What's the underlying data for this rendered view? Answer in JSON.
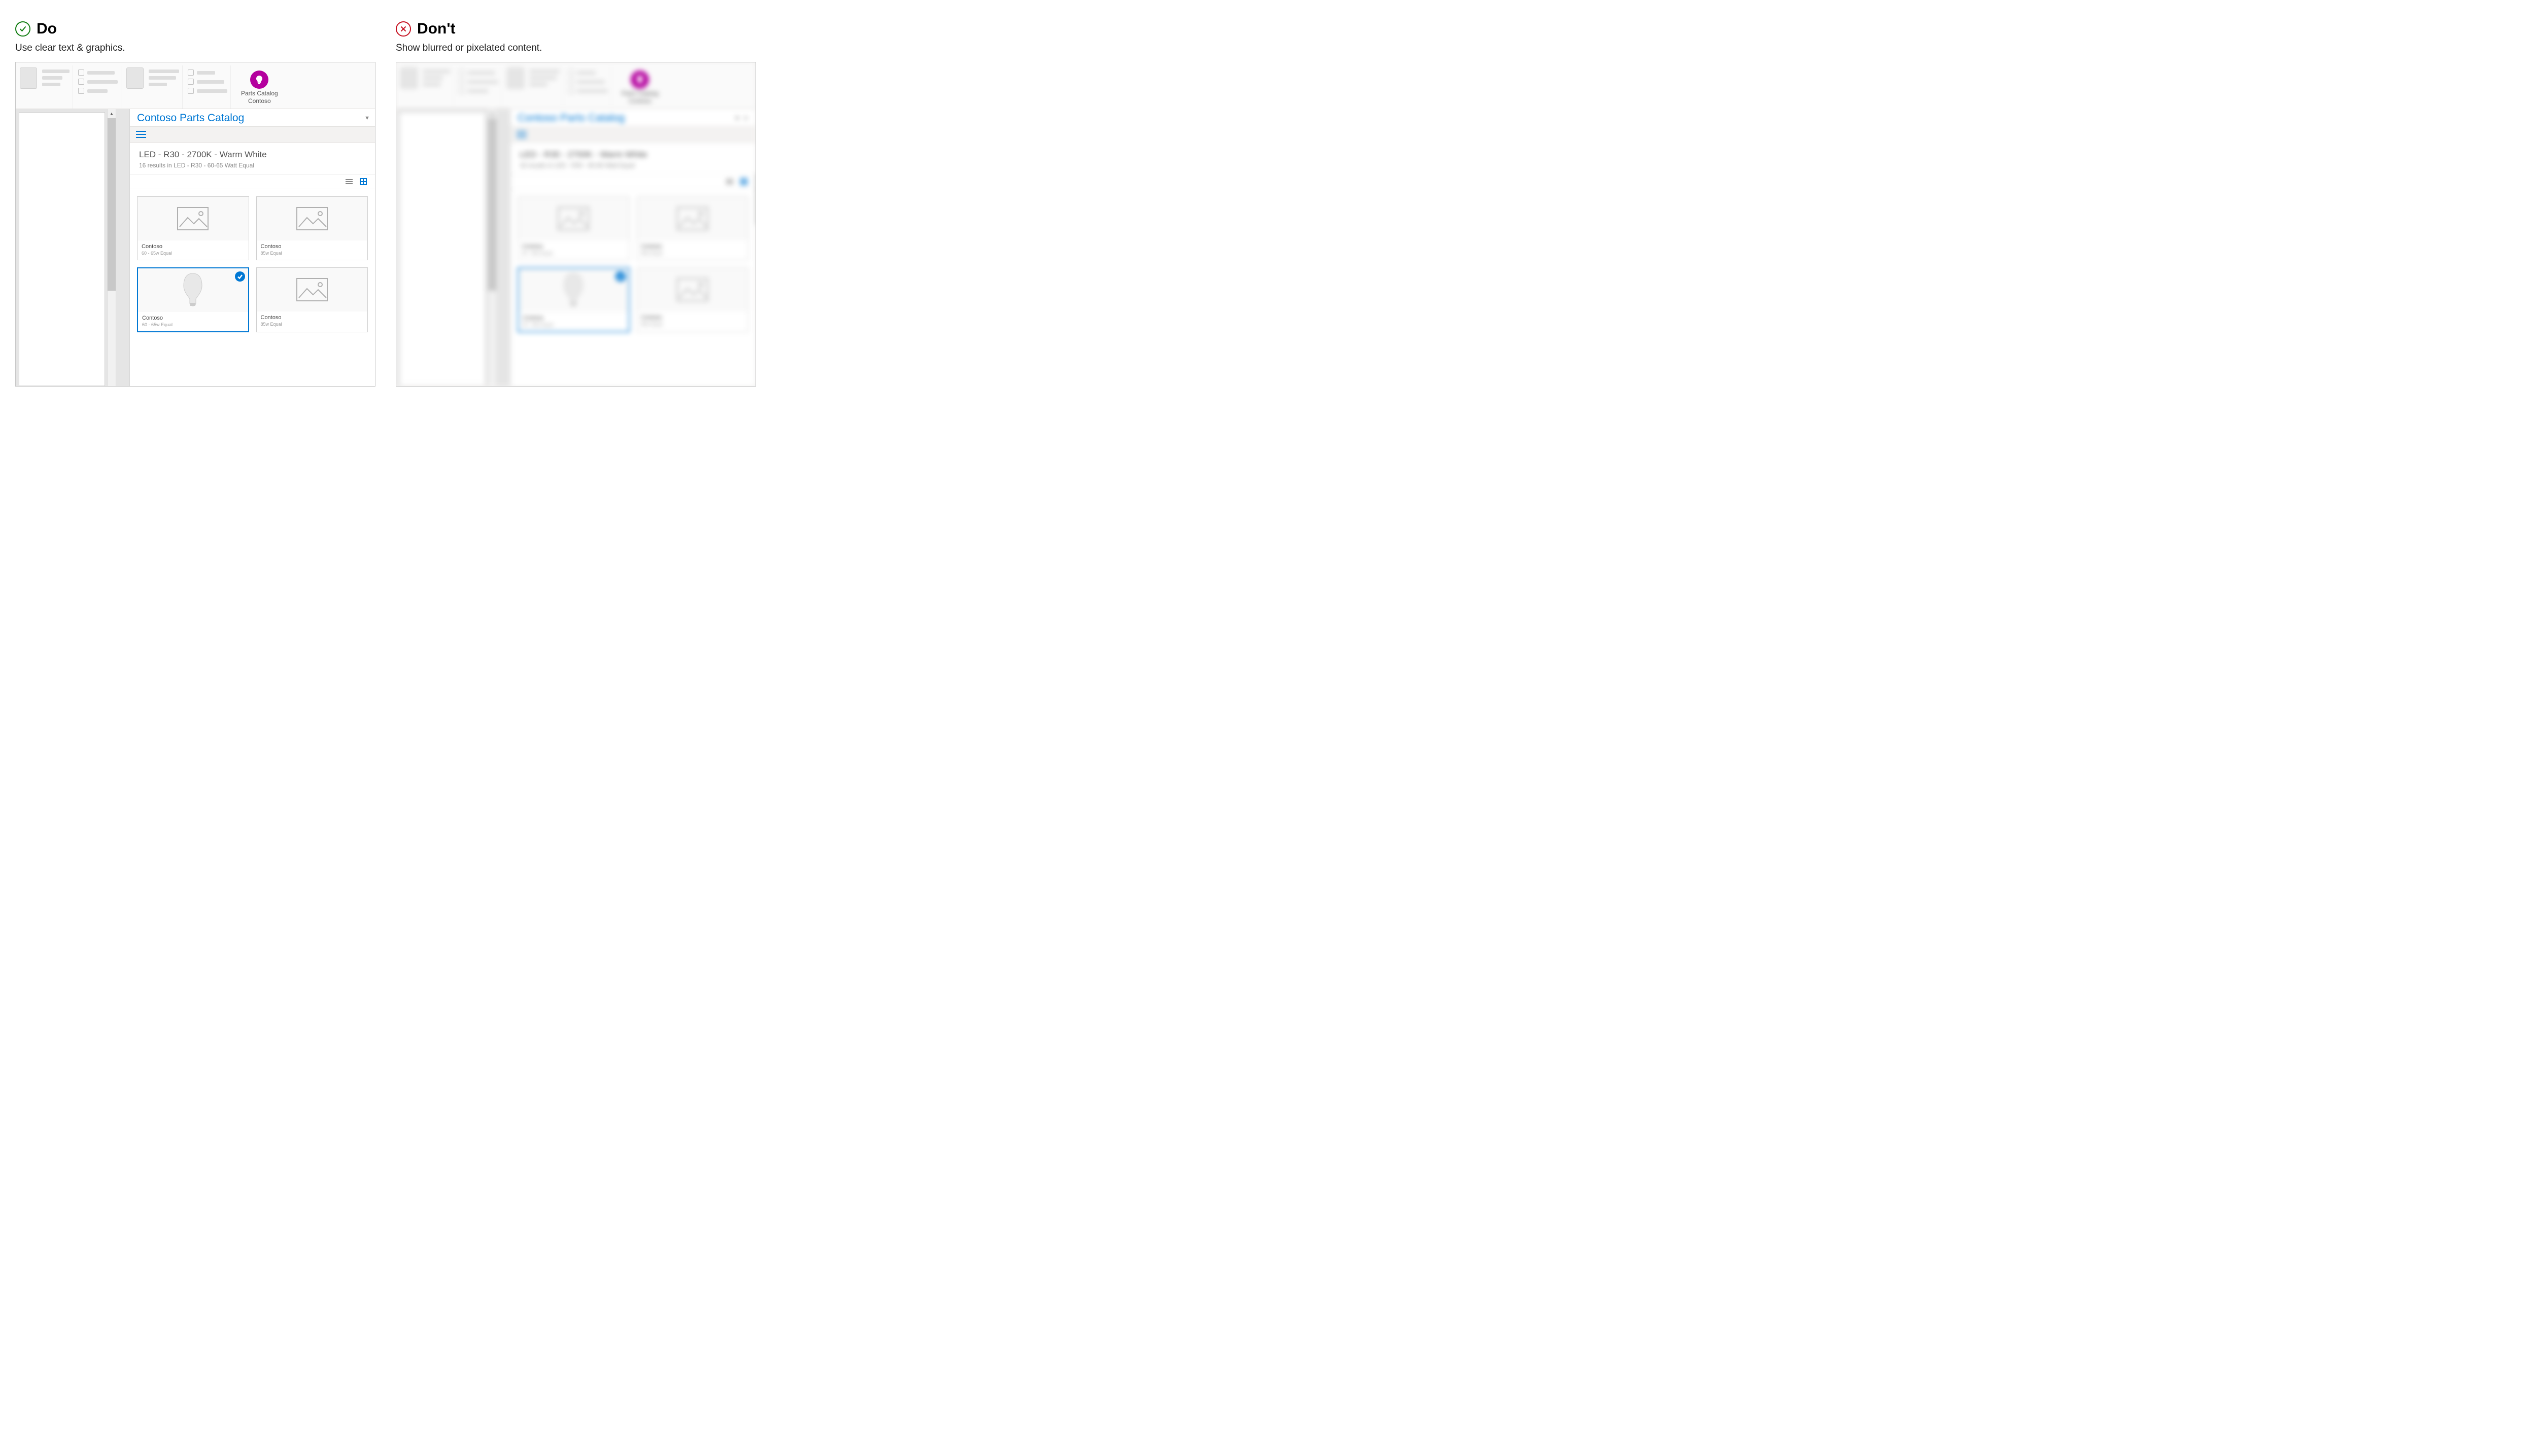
{
  "do": {
    "heading": "Do",
    "subtext": "Use clear text & graphics."
  },
  "dont": {
    "heading": "Don't",
    "subtext": "Show blurred or pixelated content."
  },
  "addin": {
    "title": "Parts Catalog",
    "publisher": "Contoso"
  },
  "taskpane": {
    "title": "Contoso Parts Catalog",
    "search_title": "LED - R30 - 2700K - Warm White",
    "search_sub": "16 results in LED - R30 - 60-65 Watt Equal"
  },
  "products": [
    {
      "brand": "Contoso",
      "spec": "60 - 65w Equal",
      "selected": false,
      "type": "placeholder"
    },
    {
      "brand": "Contoso",
      "spec": "85w Equal",
      "selected": false,
      "type": "placeholder"
    },
    {
      "brand": "Contoso",
      "spec": "60 - 65w Equal",
      "selected": true,
      "type": "bulb"
    },
    {
      "brand": "Contoso",
      "spec": "85w Equal",
      "selected": false,
      "type": "placeholder"
    }
  ]
}
